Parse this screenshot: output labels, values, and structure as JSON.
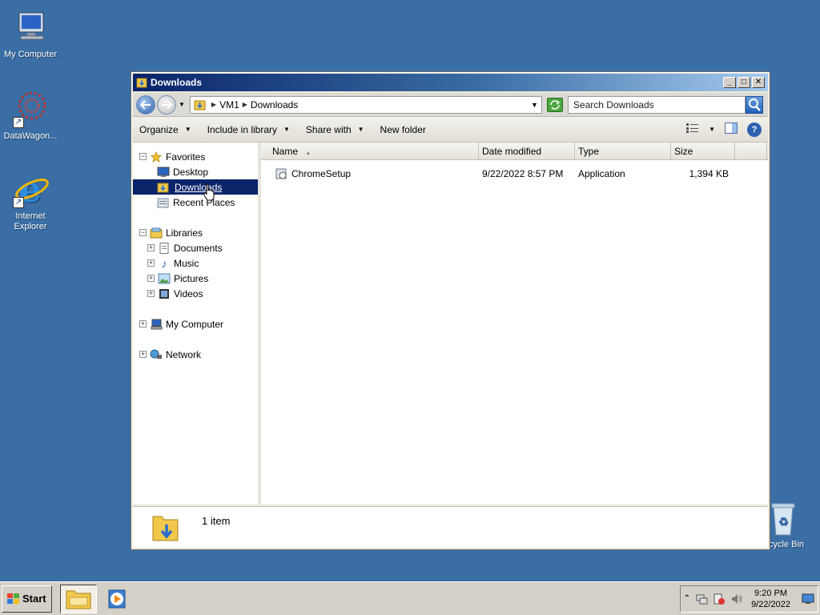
{
  "desktop": {
    "icons": [
      {
        "label": "My Computer"
      },
      {
        "label": "DataWagon..."
      },
      {
        "label": "Internet Explorer"
      },
      {
        "label": "cycle Bin"
      }
    ]
  },
  "window": {
    "title": "Downloads",
    "address": {
      "crumbs": [
        "VM1",
        "Downloads"
      ]
    },
    "search": {
      "placeholder": "Search Downloads"
    },
    "toolbar": {
      "organize": "Organize",
      "include_in_library": "Include in library",
      "share_with": "Share with",
      "new_folder": "New folder"
    },
    "nav": {
      "favorites": "Favorites",
      "desktop": "Desktop",
      "downloads": "Downloads",
      "recent_places": "Recent Places",
      "libraries": "Libraries",
      "documents": "Documents",
      "music": "Music",
      "pictures": "Pictures",
      "videos": "Videos",
      "my_computer": "My Computer",
      "network": "Network"
    },
    "columns": [
      "Name",
      "Date modified",
      "Type",
      "Size"
    ],
    "files": [
      {
        "name": "ChromeSetup",
        "date": "9/22/2022 8:57 PM",
        "type": "Application",
        "size": "1,394 KB"
      }
    ],
    "status": {
      "item_count": "1 item"
    }
  },
  "taskbar": {
    "start": "Start",
    "clock_time": "9:20 PM",
    "clock_date": "9/22/2022"
  }
}
